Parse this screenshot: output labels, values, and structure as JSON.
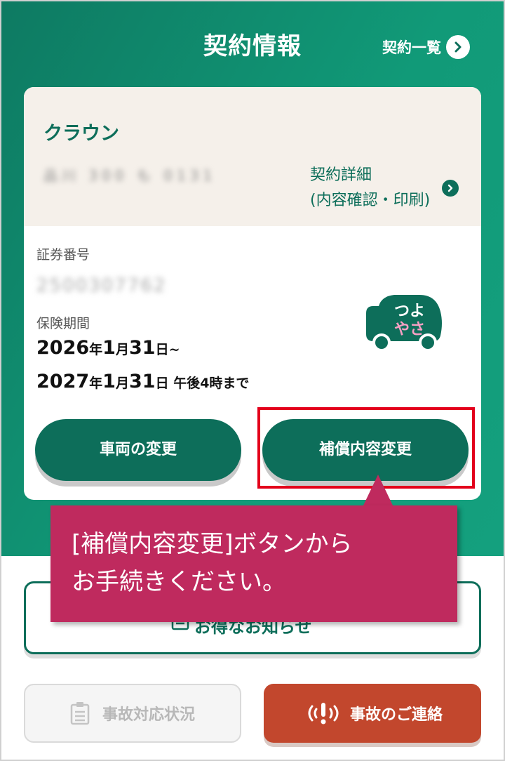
{
  "header": {
    "title": "契約情報",
    "list_link": "契約一覧"
  },
  "card": {
    "car_name": "クラウン",
    "plate": "品川 300 も 0131",
    "detail_link_line1": "契約詳細",
    "detail_link_line2": "(内容確認・印刷)",
    "policy_label": "証券番号",
    "policy_number": "2500307762",
    "period_label": "保険期間",
    "period_start_main": "2026",
    "period_start_y": "年",
    "period_start_m": "1",
    "period_start_mu": "月",
    "period_start_d": "31",
    "period_start_du": "日",
    "period_start_suffix": "~",
    "period_end_main": "2027",
    "period_end_y": "年",
    "period_end_m": "1",
    "period_end_mu": "月",
    "period_end_d": "31",
    "period_end_du": "日",
    "period_end_suffix": " 午後4時まで",
    "badge_line1": "つよ",
    "badge_line2": "やさ",
    "btn_vehicle": "車両の変更",
    "btn_coverage": "補償内容変更"
  },
  "callout": {
    "line1": "[補償内容変更]ボタンから",
    "line2": "お手続きください。"
  },
  "notice": {
    "label": "お得なお知らせ"
  },
  "bottom": {
    "status_label": "事故対応状況",
    "contact_label": "事故のご連絡"
  },
  "colors": {
    "brand_green": "#0d6e5a",
    "callout": "#bf2a5e",
    "contact_red": "#c2472d",
    "highlight": "#e3001b"
  }
}
